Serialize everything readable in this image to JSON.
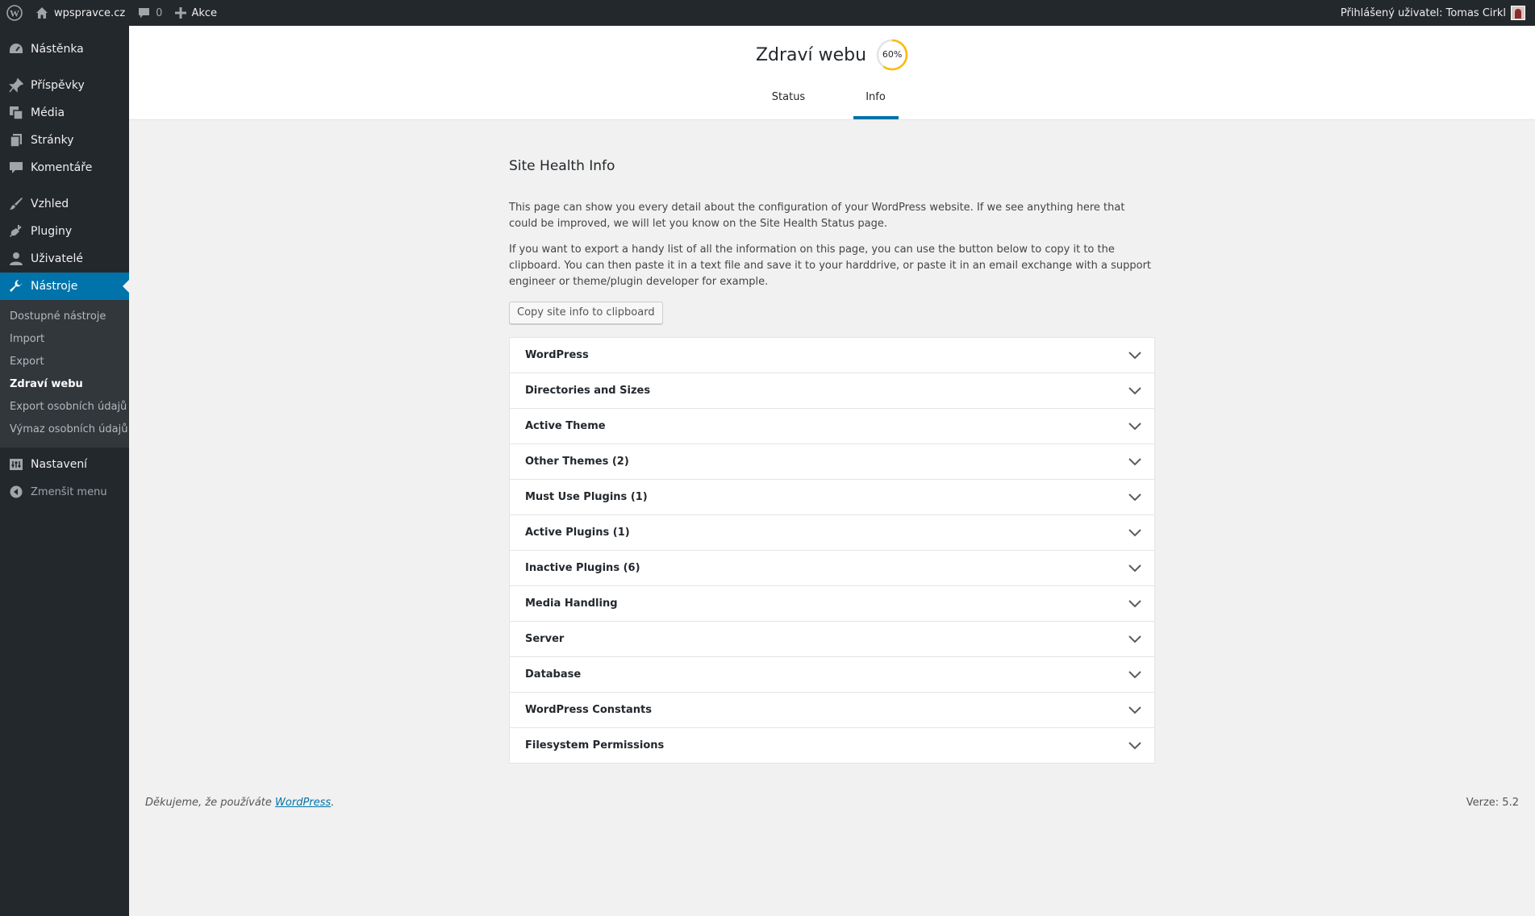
{
  "adminbar": {
    "site_name": "wpspravce.cz",
    "comments_count": "0",
    "new_label": "Akce",
    "user_greeting": "Přihlášený uživatel: Tomas Cirkl"
  },
  "sidebar": {
    "items": [
      {
        "label": "Nástěnka",
        "icon": "dashboard-icon"
      },
      {
        "label": "Příspěvky",
        "icon": "pin-icon"
      },
      {
        "label": "Média",
        "icon": "media-icon"
      },
      {
        "label": "Stránky",
        "icon": "pages-icon"
      },
      {
        "label": "Komentáře",
        "icon": "comment-icon"
      },
      {
        "label": "Vzhled",
        "icon": "brush-icon"
      },
      {
        "label": "Pluginy",
        "icon": "plug-icon"
      },
      {
        "label": "Uživatelé",
        "icon": "user-icon"
      },
      {
        "label": "Nástroje",
        "icon": "wrench-icon"
      },
      {
        "label": "Nastavení",
        "icon": "settings-icon"
      }
    ],
    "submenu": [
      "Dostupné nástroje",
      "Import",
      "Export",
      "Zdraví webu",
      "Export osobních údajů",
      "Výmaz osobních údajů"
    ],
    "collapse_label": "Zmenšit menu"
  },
  "header": {
    "title": "Zdraví webu",
    "score_label": "60%",
    "score_fraction": 0.6,
    "tabs": [
      "Status",
      "Info"
    ],
    "active_tab": "Info"
  },
  "main": {
    "section_title": "Site Health Info",
    "intro_1": "This page can show you every detail about the configuration of your WordPress website. If we see anything here that could be improved, we will let you know on the Site Health Status page.",
    "intro_2": "If you want to export a handy list of all the information on this page, you can use the button below to copy it to the clipboard. You can then paste it in a text file and save it to your harddrive, or paste it in an email exchange with a support engineer or theme/plugin developer for example.",
    "copy_button": "Copy site info to clipboard",
    "sections": [
      "WordPress",
      "Directories and Sizes",
      "Active Theme",
      "Other Themes (2)",
      "Must Use Plugins (1)",
      "Active Plugins (1)",
      "Inactive Plugins (6)",
      "Media Handling",
      "Server",
      "Database",
      "WordPress Constants",
      "Filesystem Permissions"
    ]
  },
  "footer": {
    "thanks_prefix": "Děkujeme, že používáte ",
    "thanks_link": "WordPress",
    "thanks_suffix": ".",
    "version": "Verze: 5.2"
  },
  "colors": {
    "admin_bg": "#23282d",
    "accent": "#0073aa",
    "score_ring": "#ffb900",
    "page_bg": "#f1f1f1"
  }
}
